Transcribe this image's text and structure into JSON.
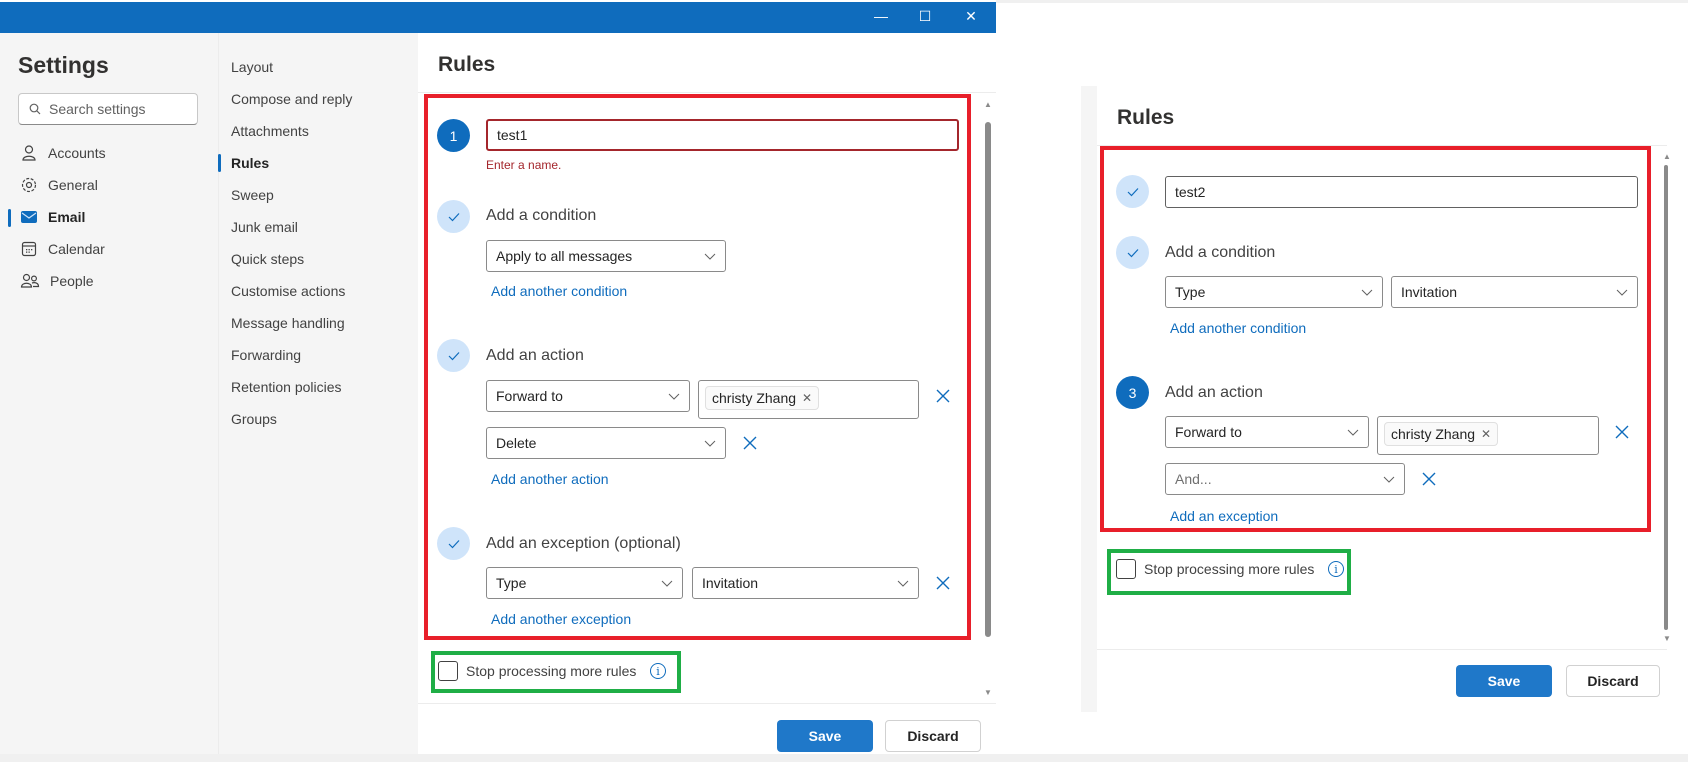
{
  "window": {
    "controls": {
      "minimize": "—",
      "maximize": "☐",
      "close": "✕"
    }
  },
  "settings": {
    "title": "Settings",
    "search_placeholder": "Search settings",
    "nav": [
      {
        "label": "Accounts",
        "icon": "person-icon"
      },
      {
        "label": "General",
        "icon": "gear-icon"
      },
      {
        "label": "Email",
        "icon": "mail-icon",
        "active": true
      },
      {
        "label": "Calendar",
        "icon": "calendar-icon"
      },
      {
        "label": "People",
        "icon": "people-icon"
      }
    ],
    "sub_nav": [
      {
        "label": "Layout"
      },
      {
        "label": "Compose and reply"
      },
      {
        "label": "Attachments"
      },
      {
        "label": "Rules",
        "active": true
      },
      {
        "label": "Sweep"
      },
      {
        "label": "Junk email"
      },
      {
        "label": "Quick steps"
      },
      {
        "label": "Customise actions"
      },
      {
        "label": "Message handling"
      },
      {
        "label": "Forwarding"
      },
      {
        "label": "Retention policies"
      },
      {
        "label": "Groups"
      }
    ]
  },
  "left_rule": {
    "title": "Rules",
    "step1": {
      "badge": "1",
      "name_value": "test1",
      "error": "Enter a name."
    },
    "condition": {
      "label": "Add a condition",
      "dropdown": "Apply to all messages",
      "add_link": "Add another condition"
    },
    "action": {
      "label": "Add an action",
      "dropdown1": "Forward to",
      "recipient": "christy Zhang",
      "dropdown2": "Delete",
      "add_link": "Add another action"
    },
    "exception": {
      "label": "Add an exception (optional)",
      "dropdown1": "Type",
      "dropdown2": "Invitation",
      "add_link": "Add another exception"
    },
    "stop_processing": {
      "label": "Stop processing more rules",
      "checked": false
    },
    "save": "Save",
    "discard": "Discard"
  },
  "right_rule": {
    "title": "Rules",
    "name_value": "test2",
    "condition": {
      "label": "Add a condition",
      "dropdown1": "Type",
      "dropdown2": "Invitation",
      "add_link": "Add another condition"
    },
    "action": {
      "badge": "3",
      "label": "Add an action",
      "dropdown1": "Forward to",
      "recipient": "christy Zhang",
      "dropdown2_placeholder": "And...",
      "add_link": "Add an exception"
    },
    "stop_processing": {
      "label": "Stop processing more rules",
      "checked": false
    },
    "save": "Save",
    "discard": "Discard"
  },
  "colors": {
    "brand": "#0f6cbd",
    "annotation_red": "#e81f2a",
    "annotation_green": "#1fae46",
    "error": "#a4262c"
  }
}
